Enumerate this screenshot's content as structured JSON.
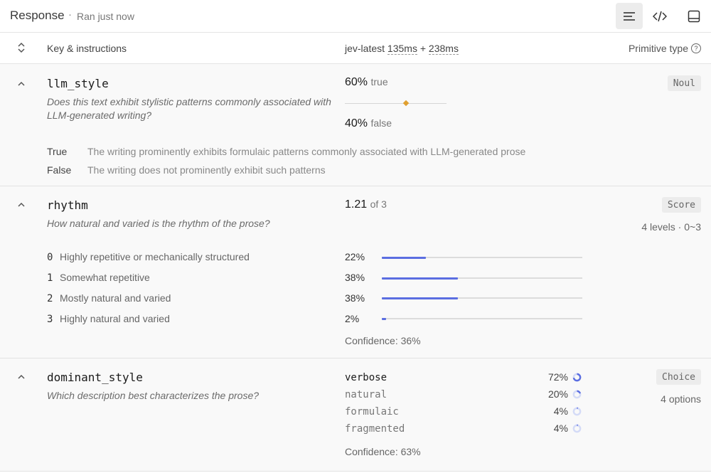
{
  "header": {
    "title": "Response",
    "separator": "·",
    "status": "Ran just now"
  },
  "toolbar": {
    "buttons": [
      {
        "icon": "text-lines-icon",
        "active": true
      },
      {
        "icon": "code-icon",
        "active": false
      },
      {
        "icon": "panel-icon",
        "active": false
      }
    ]
  },
  "columns": {
    "key_label": "Key & instructions",
    "model": "jev-latest",
    "latency_a": "135ms",
    "plus": "+",
    "latency_b": "238ms",
    "primitive_label": "Primitive type",
    "help_glyph": "?"
  },
  "sections": {
    "llm_style": {
      "name": "llm_style",
      "description": "Does this text exhibit stylistic patterns commonly associated with LLM-generated writing?",
      "badge": "Noul",
      "true_pct": "60%",
      "true_label": "true",
      "false_pct": "40%",
      "false_label": "false",
      "split_fraction": 0.6,
      "definitions": [
        {
          "key": "True",
          "value": "The writing prominently exhibits formulaic patterns commonly associated with LLM-generated prose"
        },
        {
          "key": "False",
          "value": "The writing does not prominently exhibit such patterns"
        }
      ]
    },
    "rhythm": {
      "name": "rhythm",
      "description": "How natural and varied is the rhythm of the prose?",
      "badge": "Score",
      "score": "1.21",
      "of": "of 3",
      "levels_meta": "4 levels · 0~3",
      "levels": [
        {
          "num": "0",
          "label": "Highly repetitive or mechanically structured",
          "pct": "22%",
          "fraction": 0.22
        },
        {
          "num": "1",
          "label": "Somewhat repetitive",
          "pct": "38%",
          "fraction": 0.38
        },
        {
          "num": "2",
          "label": "Mostly natural and varied",
          "pct": "38%",
          "fraction": 0.38
        },
        {
          "num": "3",
          "label": "Highly natural and varied",
          "pct": "2%",
          "fraction": 0.02
        }
      ],
      "confidence": "Confidence: 36%"
    },
    "dominant_style": {
      "name": "dominant_style",
      "description": "Which description best characterizes the prose?",
      "badge": "Choice",
      "options_meta": "4 options",
      "options": [
        {
          "name": "verbose",
          "pct": "72%",
          "fraction": 0.72
        },
        {
          "name": "natural",
          "pct": "20%",
          "fraction": 0.2
        },
        {
          "name": "formulaic",
          "pct": "4%",
          "fraction": 0.04
        },
        {
          "name": "fragmented",
          "pct": "4%",
          "fraction": 0.04
        }
      ],
      "confidence": "Confidence: 63%"
    }
  },
  "colors": {
    "accent_blue": "#5b6ee1",
    "marker_orange": "#e0a030",
    "section_bg": "#f9f9f9"
  }
}
